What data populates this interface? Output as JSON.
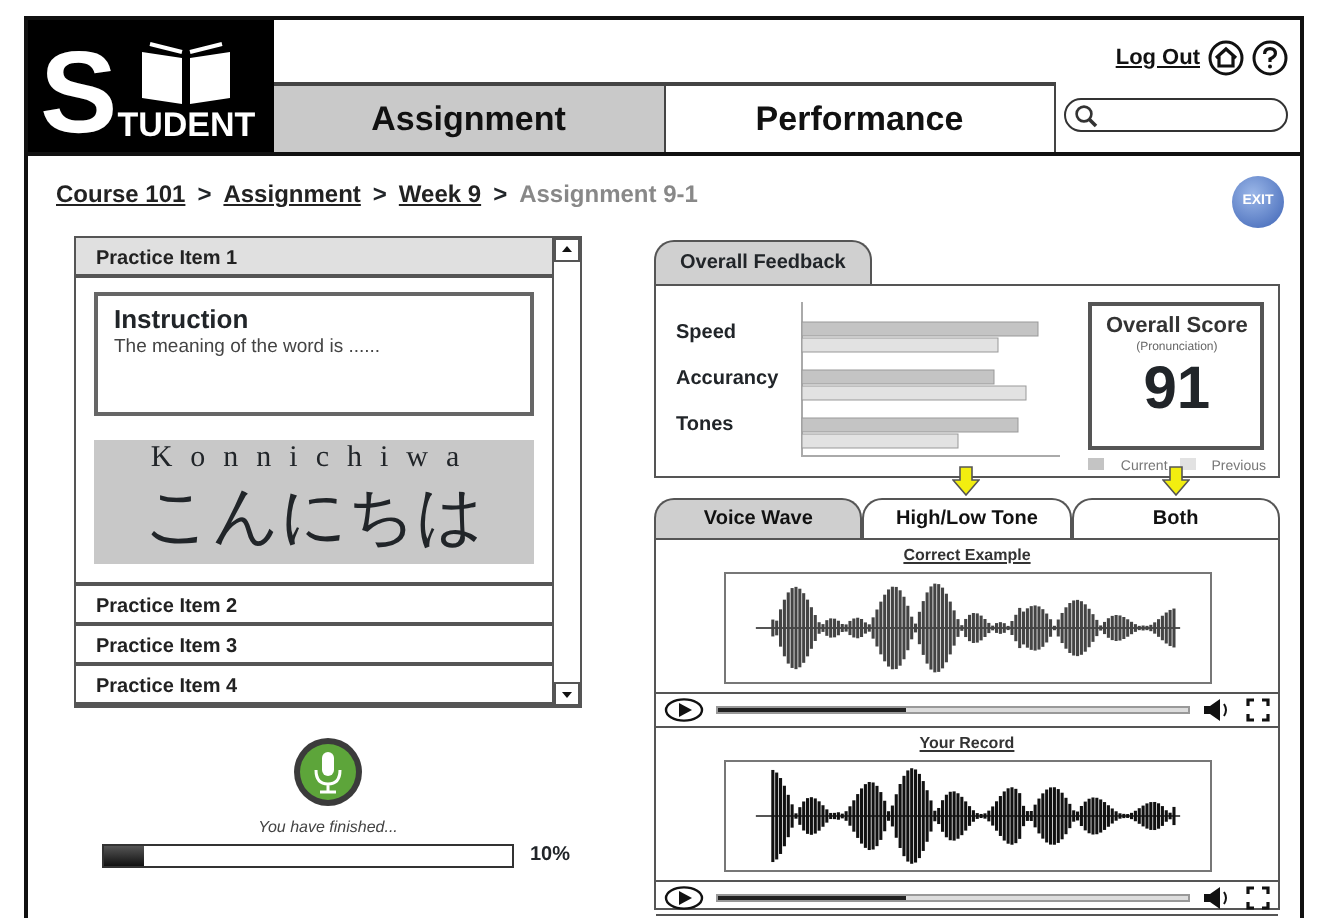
{
  "header": {
    "logo": {
      "initial": "S",
      "rest": "TUDENT"
    },
    "tabs": [
      {
        "label": "Assignment",
        "selected": true
      },
      {
        "label": "Performance",
        "selected": false
      }
    ],
    "log_out": "Log Out"
  },
  "breadcrumb": [
    {
      "label": "Course 101",
      "kind": "link"
    },
    {
      "label": ">",
      "kind": "separator"
    },
    {
      "label": "Assignment",
      "kind": "link"
    },
    {
      "label": ">",
      "kind": "separator"
    },
    {
      "label": "Week 9",
      "kind": "link"
    },
    {
      "label": ">",
      "kind": "separator"
    },
    {
      "label": "Assignment 9-1",
      "kind": "current"
    }
  ],
  "exit_button": "EXIT",
  "practice_items": [
    {
      "label": "Practice Item 1",
      "expanded": true,
      "instruction_title": "Instruction",
      "instruction_text": "The meaning of the word is ......",
      "romaji": "Konnichiwa",
      "kana": "こんにちは"
    },
    {
      "label": "Practice Item 2",
      "expanded": false
    },
    {
      "label": "Practice Item 3",
      "expanded": false
    },
    {
      "label": "Practice Item 4",
      "expanded": false
    }
  ],
  "recording": {
    "status": "You have finished...",
    "level": 0.1,
    "reading": "10%"
  },
  "feedback": {
    "tab": "Overall Feedback",
    "categories": [
      "Speed",
      "Accurancy",
      "Tones"
    ],
    "series": [
      {
        "name": "Current",
        "color": "#c4c4c4"
      },
      {
        "name": "Previous",
        "color": "#e2e2e2"
      }
    ],
    "score_title": "Overall Score",
    "score_subtitle": "(Pronunciation)",
    "score": "91"
  },
  "view_tabs": [
    {
      "label": "Voice Wave",
      "selected": true,
      "flagged": false
    },
    {
      "label": "High/Low Tone",
      "selected": false,
      "flagged": true
    },
    {
      "label": "Both",
      "selected": false,
      "flagged": true
    }
  ],
  "players": [
    {
      "title": "Correct Example",
      "level": 0.4
    },
    {
      "title": "Your Record",
      "level": 0.4
    }
  ]
}
